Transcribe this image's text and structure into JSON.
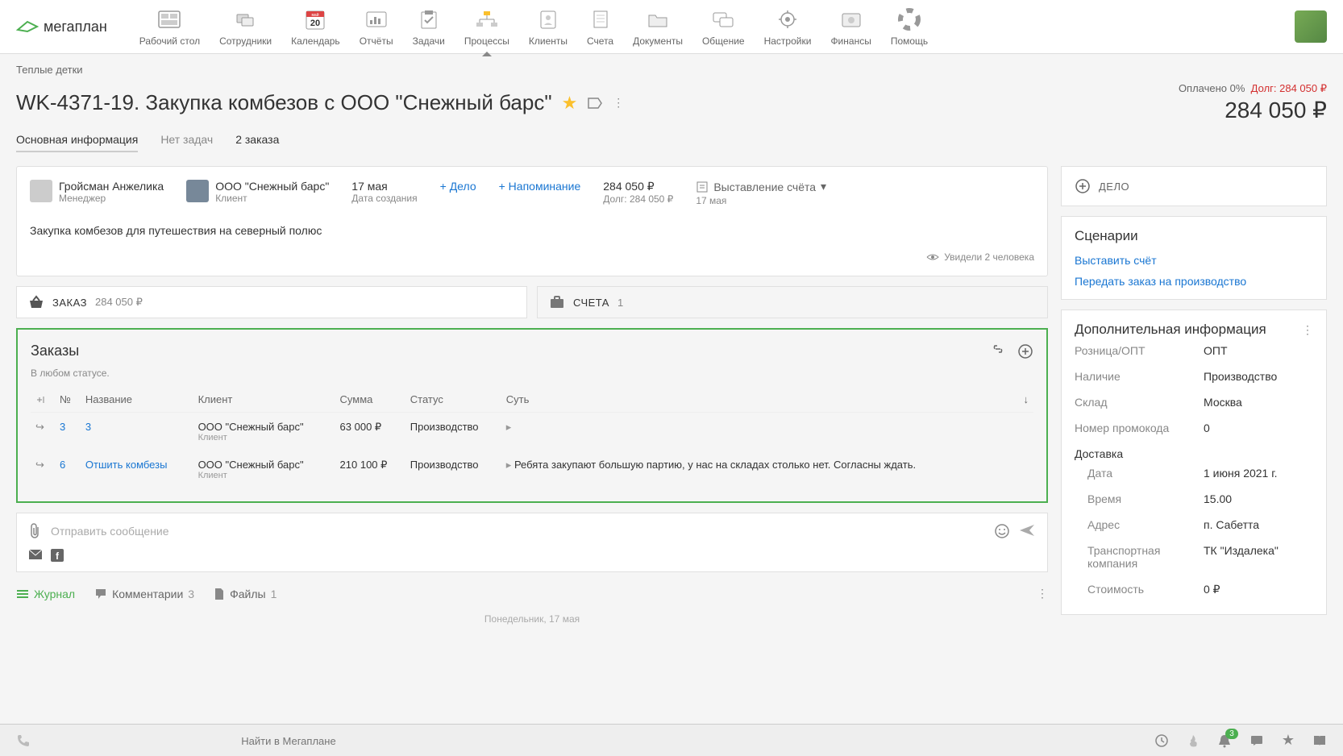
{
  "brand": "мегаплан",
  "nav": {
    "items": [
      {
        "label": "Рабочий стол"
      },
      {
        "label": "Сотрудники"
      },
      {
        "label": "Календарь",
        "day": "20",
        "month": "май"
      },
      {
        "label": "Отчёты"
      },
      {
        "label": "Задачи"
      },
      {
        "label": "Процессы"
      },
      {
        "label": "Клиенты"
      },
      {
        "label": "Счета"
      },
      {
        "label": "Документы"
      },
      {
        "label": "Общение"
      },
      {
        "label": "Настройки"
      },
      {
        "label": "Финансы"
      },
      {
        "label": "Помощь"
      }
    ]
  },
  "breadcrumb": "Теплые детки",
  "deal": {
    "title": "WK-4371-19. Закупка комбезов с ООО \"Снежный барс\"",
    "paid_label": "Оплачено 0%",
    "debt_label": "Долг: 284 050 ₽",
    "amount": "284 050 ₽"
  },
  "page_tabs": {
    "main": "Основная информация",
    "no_tasks": "Нет задач",
    "orders": "2 заказа"
  },
  "summary": {
    "manager": {
      "name": "Гройсман Анжелика",
      "role": "Менеджер"
    },
    "client": {
      "name": "ООО \"Снежный барс\"",
      "role": "Клиент"
    },
    "created": {
      "value": "17 мая",
      "label": "Дата создания"
    },
    "add_deal": "+ Дело",
    "add_reminder": "+ Напоминание",
    "amount": "284 050 ₽",
    "debt": "Долг: 284 050 ₽",
    "status": "Выставление счёта",
    "status_date": "17 мая",
    "description": "Закупка комбезов для путешествия на северный полюс",
    "seen": "Увидели 2 человека"
  },
  "tab_cards": {
    "order": {
      "label": "ЗАКАЗ",
      "value": "284 050 ₽"
    },
    "invoices": {
      "label": "СЧЕТА",
      "value": "1"
    }
  },
  "orders": {
    "title": "Заказы",
    "status_filter": "В любом статусе.",
    "cols": {
      "num": "№",
      "name": "Название",
      "client": "Клиент",
      "sum": "Сумма",
      "status": "Статус",
      "essence": "Суть"
    },
    "rows": [
      {
        "num": "3",
        "name": "3",
        "client": "ООО \"Снежный барс\"",
        "client_role": "Клиент",
        "sum": "63 000 ₽",
        "status": "Производство",
        "essence": ""
      },
      {
        "num": "6",
        "name": "Отшить комбезы",
        "client": "ООО \"Снежный барс\"",
        "client_role": "Клиент",
        "sum": "210 100 ₽",
        "status": "Производство",
        "essence": "Ребята закупают большую партию, у нас на складах столько нет. Согласны ждать."
      }
    ]
  },
  "compose": {
    "placeholder": "Отправить сообщение"
  },
  "feed": {
    "journal": "Журнал",
    "comments": "Комментарии",
    "comments_count": "3",
    "files": "Файлы",
    "files_count": "1",
    "date": "Понедельник, 17 мая"
  },
  "side": {
    "add_deal": "ДЕЛО",
    "scenarios": {
      "title": "Сценарии",
      "invoice": "Выставить счёт",
      "production": "Передать заказ на производство"
    },
    "info": {
      "title": "Дополнительная информация",
      "retail": {
        "k": "Розница/ОПТ",
        "v": "ОПТ"
      },
      "availability": {
        "k": "Наличие",
        "v": "Производство"
      },
      "warehouse": {
        "k": "Склад",
        "v": "Москва"
      },
      "promo": {
        "k": "Номер промокода",
        "v": "0"
      },
      "delivery_hdr": "Доставка",
      "date": {
        "k": "Дата",
        "v": "1 июня 2021 г."
      },
      "time": {
        "k": "Время",
        "v": "15.00"
      },
      "address": {
        "k": "Адрес",
        "v": "п. Сабетта"
      },
      "carrier": {
        "k": "Транспортная компания",
        "v": "ТК \"Издалека\""
      },
      "cost": {
        "k": "Стоимость",
        "v": "0 ₽"
      }
    }
  },
  "bottom": {
    "search_placeholder": "Найти в Мегаплане",
    "notif_count": "3"
  }
}
